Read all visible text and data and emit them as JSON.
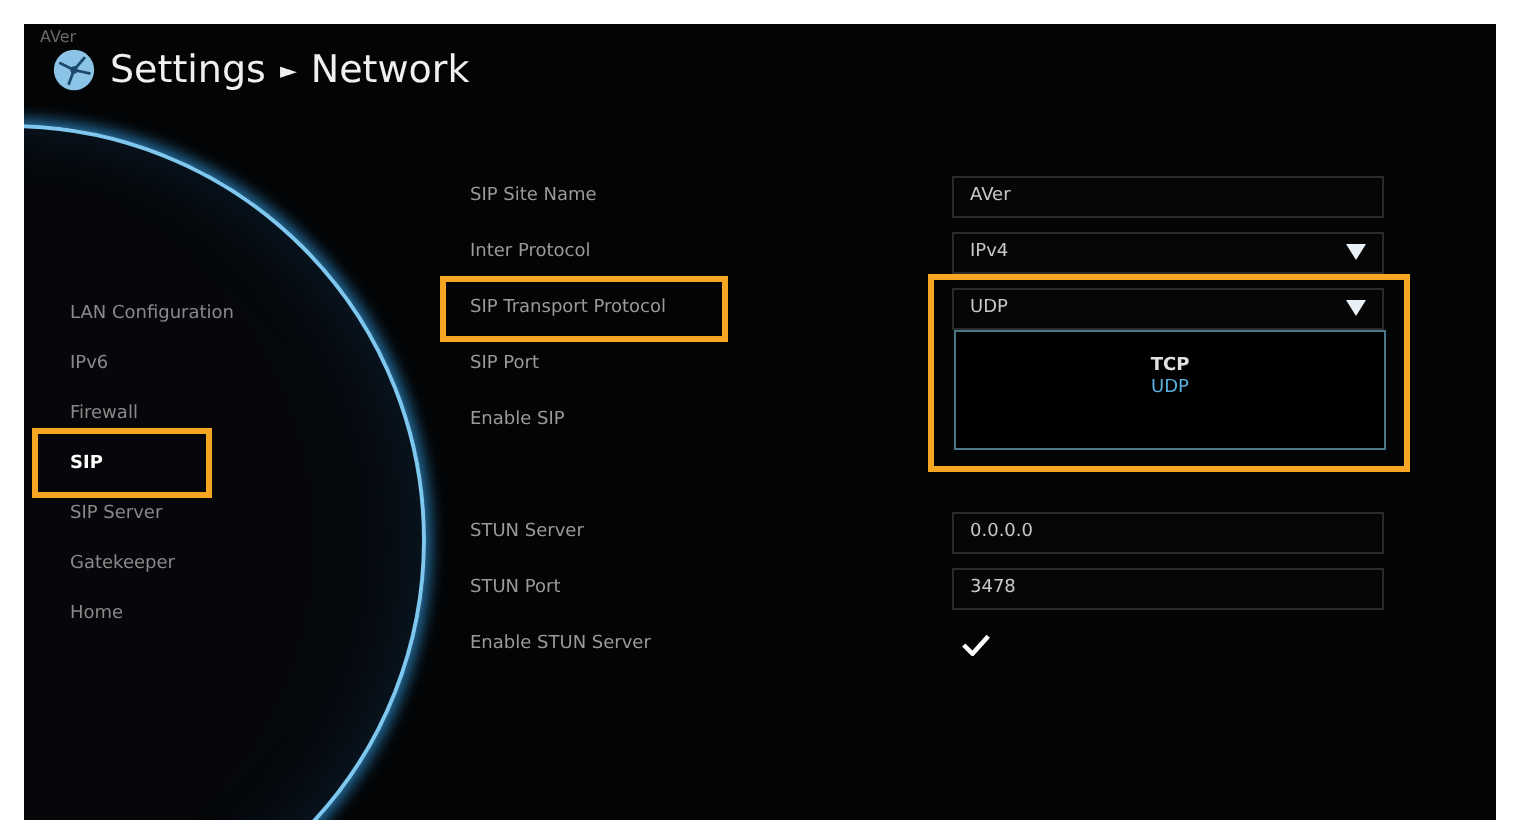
{
  "brand": "AVer",
  "breadcrumb": [
    "Settings",
    "Network"
  ],
  "breadcrumb_separator": "►",
  "menu": [
    {
      "label": "LAN Configuration",
      "selected": false,
      "highlighted": false
    },
    {
      "label": "IPv6",
      "selected": false,
      "highlighted": false
    },
    {
      "label": "Firewall",
      "selected": false,
      "highlighted": false
    },
    {
      "label": "SIP",
      "selected": true,
      "highlighted": true
    },
    {
      "label": "SIP Server",
      "selected": false,
      "highlighted": false
    },
    {
      "label": "Gatekeeper",
      "selected": false,
      "highlighted": false
    },
    {
      "label": "Home",
      "selected": false,
      "highlighted": false
    }
  ],
  "form": {
    "groups": [
      {
        "rows": [
          {
            "label": "SIP Site Name",
            "kind": "text",
            "value": "AVer",
            "highlighted": false
          },
          {
            "label": "Inter Protocol",
            "kind": "select",
            "value": "IPv4",
            "highlighted": false
          },
          {
            "label": "SIP Transport Protocol",
            "kind": "select",
            "value": "UDP",
            "expanded": true,
            "highlighted": true,
            "options": [
              {
                "label": "TCP",
                "selected": false
              },
              {
                "label": "UDP",
                "selected": true
              }
            ]
          },
          {
            "label": "SIP Port",
            "kind": "covered",
            "highlighted": false
          },
          {
            "label": "Enable SIP",
            "kind": "covered",
            "highlighted": false
          }
        ]
      },
      {
        "rows": [
          {
            "label": "STUN Server",
            "kind": "text",
            "value": "0.0.0.0",
            "highlighted": false
          },
          {
            "label": "STUN Port",
            "kind": "text",
            "value": "3478",
            "highlighted": false
          },
          {
            "label": "Enable STUN Server",
            "kind": "checkbox",
            "checked": true,
            "highlighted": false
          }
        ]
      }
    ]
  }
}
